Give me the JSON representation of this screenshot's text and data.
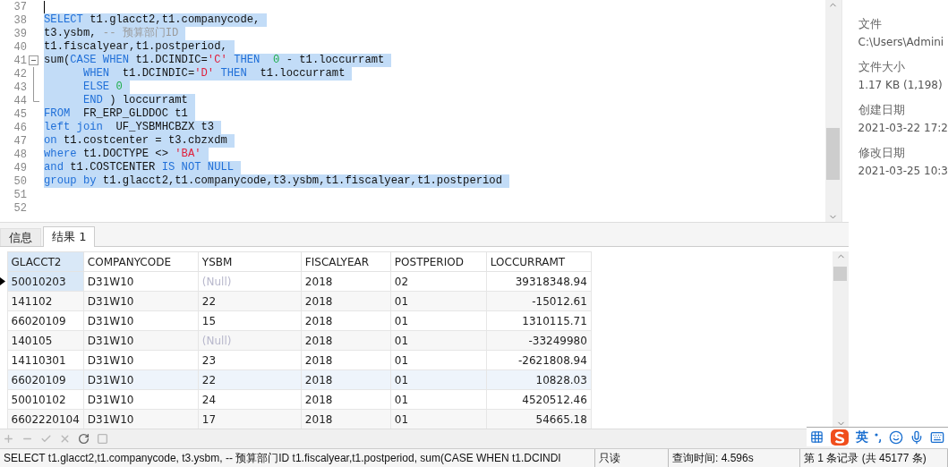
{
  "editor": {
    "lines": [
      {
        "number": "37",
        "cursor": true
      },
      {
        "number": "38",
        "selected": true,
        "tokens": [
          {
            "kind": "kw",
            "text": "SELECT"
          },
          {
            "kind": "plain",
            "text": " t1.glacct2,t1.companycode,"
          }
        ]
      },
      {
        "number": "39",
        "selected": true,
        "tokens": [
          {
            "kind": "plain",
            "text": "t3.ysbm, "
          },
          {
            "kind": "cmt",
            "text": "-- 预算部门ID"
          }
        ]
      },
      {
        "number": "40",
        "selected": true,
        "tokens": [
          {
            "kind": "plain",
            "text": "t1.fiscalyear,t1.postperiod,"
          }
        ]
      },
      {
        "number": "41",
        "selected": true,
        "fold": {
          "expanded": true
        },
        "tokens": [
          {
            "kind": "plain",
            "text": "sum("
          },
          {
            "kind": "kw",
            "text": "CASE WHEN"
          },
          {
            "kind": "plain",
            "text": " t1.DCINDIC="
          },
          {
            "kind": "str",
            "text": "'C'"
          },
          {
            "kind": "kw",
            "text": " THEN"
          },
          {
            "kind": "num",
            "text": "  0"
          },
          {
            "kind": "plain",
            "text": " - t1.loccurramt"
          }
        ]
      },
      {
        "number": "42",
        "selected": true,
        "in_fold": true,
        "tokens": [
          {
            "kind": "kw",
            "text": "      WHEN"
          },
          {
            "kind": "plain",
            "text": "  t1.DCINDIC="
          },
          {
            "kind": "str",
            "text": "'D'"
          },
          {
            "kind": "kw",
            "text": " THEN"
          },
          {
            "kind": "plain",
            "text": "  t1.loccurramt"
          }
        ]
      },
      {
        "number": "43",
        "selected": true,
        "in_fold": true,
        "tokens": [
          {
            "kind": "kw",
            "text": "      ELSE"
          },
          {
            "kind": "num",
            "text": " 0"
          }
        ]
      },
      {
        "number": "44",
        "selected": true,
        "in_fold": true,
        "tokens": [
          {
            "kind": "kw",
            "text": "      END"
          },
          {
            "kind": "plain",
            "text": " ) loccurramt"
          }
        ]
      },
      {
        "number": "45",
        "selected": true,
        "tokens": [
          {
            "kind": "kw",
            "text": "FROM"
          },
          {
            "kind": "plain",
            "text": "  FR_ERP_GLDDOC t1"
          }
        ]
      },
      {
        "number": "46",
        "selected": true,
        "tokens": [
          {
            "kind": "kw",
            "text": "left join"
          },
          {
            "kind": "plain",
            "text": "  UF_YSBMHCBZX t3"
          }
        ]
      },
      {
        "number": "47",
        "selected": true,
        "tokens": [
          {
            "kind": "kw",
            "text": "on"
          },
          {
            "kind": "plain",
            "text": " t1.costcenter = t3.cbzxdm"
          }
        ]
      },
      {
        "number": "48",
        "selected": true,
        "tokens": [
          {
            "kind": "kw",
            "text": "where"
          },
          {
            "kind": "plain",
            "text": " t1.DOCTYPE <> "
          },
          {
            "kind": "str",
            "text": "'BA'"
          }
        ]
      },
      {
        "number": "49",
        "selected": true,
        "tokens": [
          {
            "kind": "kw",
            "text": "and"
          },
          {
            "kind": "plain",
            "text": " t1.COSTCENTER "
          },
          {
            "kind": "kw",
            "text": "IS NOT NULL"
          }
        ]
      },
      {
        "number": "50",
        "selected": true,
        "tokens": [
          {
            "kind": "kw",
            "text": "group by"
          },
          {
            "kind": "plain",
            "text": " t1.glacct2,t1.companycode,t3.ysbm,t1.fiscalyear,t1.postperiod"
          }
        ]
      },
      {
        "number": "51"
      },
      {
        "number": "52"
      }
    ]
  },
  "info_panel": [
    {
      "label": "文件",
      "value": "C:\\Users\\Admini"
    },
    {
      "label": "文件大小",
      "value": "1.17 KB (1,198)"
    },
    {
      "label": "创建日期",
      "value": "2021-03-22 17:2"
    },
    {
      "label": "修改日期",
      "value": "2021-03-25 10:3"
    }
  ],
  "result_tabs": [
    {
      "label": "信息",
      "selected": false
    },
    {
      "label": "结果 1",
      "selected": true
    }
  ],
  "table": {
    "columns": [
      "GLACCT2",
      "COMPANYCODE",
      "YSBM",
      "FISCALYEAR",
      "POSTPERIOD",
      "LOCCURRAMT"
    ],
    "rows": [
      {
        "current": true,
        "highlighted": false,
        "cells": [
          "50010203",
          "D31W10",
          {
            "kind": "null",
            "text": "(Null)"
          },
          "2018",
          "02",
          "39318348.94"
        ]
      },
      {
        "current": false,
        "highlighted": false,
        "cells": [
          "141102",
          "D31W10",
          "22",
          "2018",
          "01",
          "-15012.61"
        ]
      },
      {
        "current": false,
        "highlighted": false,
        "cells": [
          "66020109",
          "D31W10",
          "15",
          "2018",
          "01",
          "1310115.71"
        ]
      },
      {
        "current": false,
        "highlighted": false,
        "cells": [
          "140105",
          "D31W10",
          {
            "kind": "null",
            "text": "(Null)"
          },
          "2018",
          "01",
          "-33249980"
        ]
      },
      {
        "current": false,
        "highlighted": false,
        "cells": [
          "14110301",
          "D31W10",
          "23",
          "2018",
          "01",
          "-2621808.94"
        ]
      },
      {
        "current": false,
        "highlighted": true,
        "cells": [
          "66020109",
          "D31W10",
          "22",
          "2018",
          "01",
          "10828.03"
        ]
      },
      {
        "current": false,
        "highlighted": false,
        "cells": [
          "50010102",
          "D31W10",
          "24",
          "2018",
          "01",
          "4520512.46"
        ]
      },
      {
        "current": false,
        "highlighted": false,
        "cells": [
          "6602220104",
          "D31W10",
          "17",
          "2018",
          "01",
          "54665.18"
        ]
      }
    ]
  },
  "toolbar": [
    {
      "kind": "plus",
      "disabled": true
    },
    {
      "kind": "minus",
      "disabled": true
    },
    {
      "kind": "check",
      "disabled": true
    },
    {
      "kind": "cross",
      "disabled": true
    },
    {
      "kind": "refresh",
      "disabled": false
    },
    {
      "kind": "stop",
      "disabled": true
    }
  ],
  "ime_bar": {
    "mode": "英"
  },
  "status_bar": {
    "sql": "SELECT t1.glacct2,t1.companycode,  t3.ysbm, -- 预算部门ID t1.fiscalyear,t1.postperiod, sum(CASE WHEN t1.DCINDI",
    "mode": "只读",
    "query_time": "查询时间: 4.596s",
    "record": "第 1 条记录 (共 45177 条)"
  }
}
